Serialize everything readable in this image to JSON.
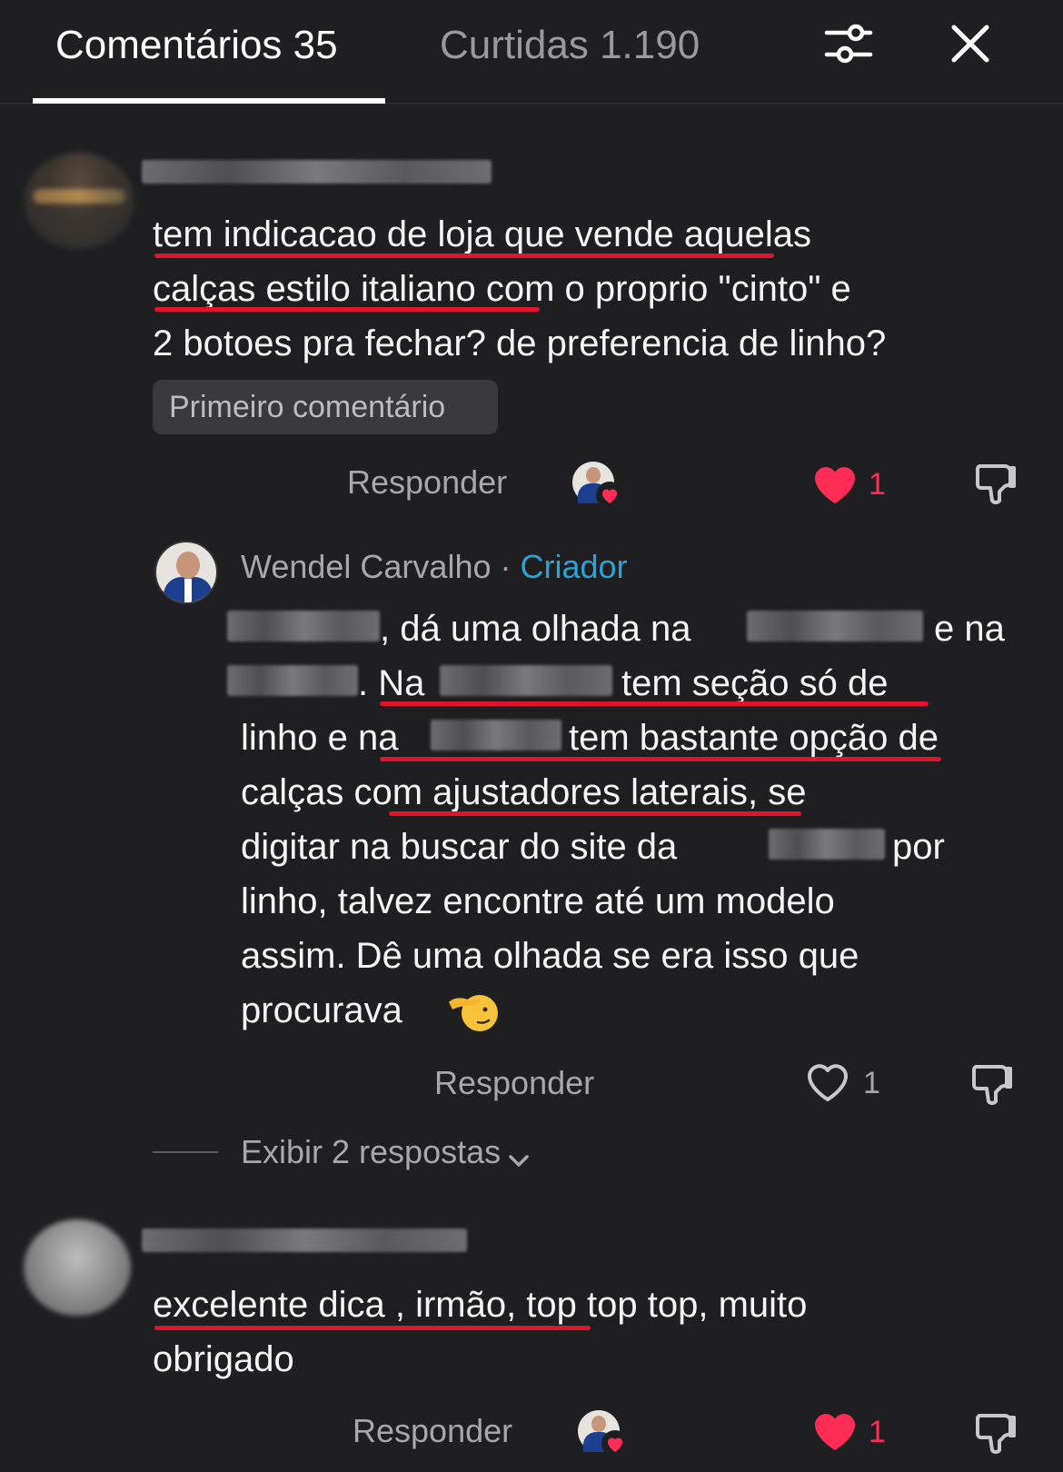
{
  "header": {
    "tab_comments": "Comentários 35",
    "tab_likes": "Curtidas 1.190",
    "filter_icon": "sliders-icon",
    "close_icon": "close-icon"
  },
  "comment1": {
    "lines": [
      "tem indicacao de loja que vende aquelas",
      "calças estilo italiano com o proprio \"cinto\" e",
      "2 botoes pra fechar? de preferencia de linho?"
    ],
    "badge": "Primeiro comentário",
    "reply_label": "Responder",
    "like_count": "1"
  },
  "reply": {
    "author": "Wendel Carvalho",
    "separator": " · ",
    "creator_tag": "Criador",
    "lines": {
      "l1a": ", dá uma olhada na",
      "l1b": "e na",
      "l2a": ". Na",
      "l2b": "tem seção só de",
      "l3a": "linho e na",
      "l3b": "tem bastante opção de",
      "l4": "calças com ajustadores laterais, se",
      "l5a": "digitar na buscar do site da",
      "l5b": "por",
      "l6": "linho, talvez encontre até um modelo",
      "l7": "assim. Dê uma olhada se era isso que",
      "l8": "procurava"
    },
    "reply_label": "Responder",
    "like_count": "1",
    "show_replies": "Exibir 2 respostas"
  },
  "comment2": {
    "lines": [
      "excelente dica , irmão, top top top, muito",
      "obrigado"
    ],
    "reply_label": "Responder",
    "like_count": "1"
  },
  "colors": {
    "background": "#1f1f21",
    "like_red": "#ff2d55",
    "underline_red": "#e0142c",
    "creator_blue": "#2aa3d8"
  }
}
